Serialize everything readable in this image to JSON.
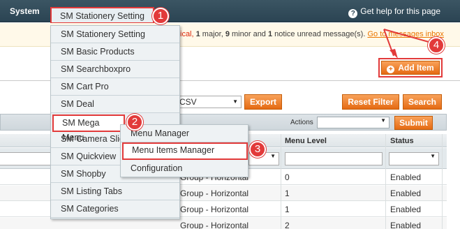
{
  "topnav": {
    "system_label": "System",
    "sm_setting_label": "SM Stationery Setting",
    "help_label": "Get help for this page",
    "help_icon": "?"
  },
  "notice": {
    "prefix": "ical, ",
    "major_count": "1",
    "major_label": " major, ",
    "minor_count": "9",
    "minor_label": " minor and ",
    "notice_count": "1",
    "notice_label": " notice unread message(s). ",
    "link_label": "Go to messages inbox"
  },
  "header": {
    "add_item_label": "Add Item",
    "add_icon": "+"
  },
  "export": {
    "format_value": "CSV",
    "export_label": "Export",
    "reset_filter_label": "Reset Filter",
    "search_label": "Search"
  },
  "grid_toolbar": {
    "actions_label": "Actions",
    "submit_label": "Submit"
  },
  "grid": {
    "columns": [
      "Menu Level",
      "Status"
    ],
    "status_filter_arrow": "▼",
    "rows": [
      {
        "group": "Group - Horizontal",
        "level": "0",
        "status": "Enabled"
      },
      {
        "group": "Group - Horizontal",
        "level": "1",
        "status": "Enabled"
      },
      {
        "group": "Group - Horizontal",
        "level": "1",
        "status": "Enabled"
      },
      {
        "group": "Group - Horizontal",
        "level": "2",
        "status": "Enabled"
      }
    ]
  },
  "dropdown": {
    "items": [
      "SM Stationery Setting",
      "SM Basic Products",
      "SM Searchboxpro",
      "SM Cart Pro",
      "SM Deal",
      "SM Mega Menu",
      "SM Camera Slider",
      "SM Quickview",
      "SM Shopby",
      "SM Listing Tabs",
      "SM Categories"
    ]
  },
  "submenu": {
    "items": [
      "Menu Manager",
      "Menu Items Manager",
      "Configuration"
    ]
  },
  "callouts": [
    "1",
    "2",
    "3",
    "4"
  ],
  "colors": {
    "accent_orange": "#e56a13",
    "highlight_red": "#e23a3a",
    "nav_bg": "#2b4453"
  }
}
